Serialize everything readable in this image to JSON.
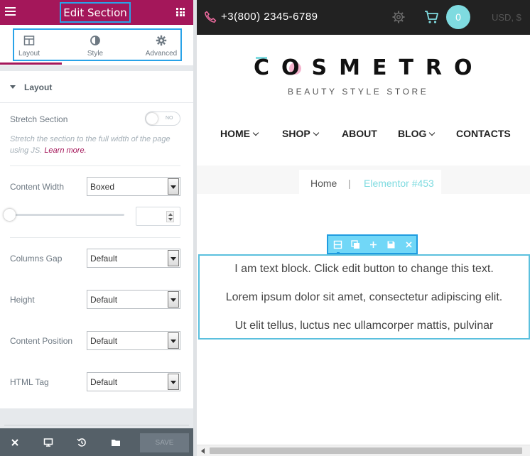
{
  "panel": {
    "title": "Edit Section",
    "tabs": [
      {
        "label": "Layout",
        "active": true
      },
      {
        "label": "Style",
        "active": false
      },
      {
        "label": "Advanced",
        "active": false
      }
    ],
    "accent_color": "#a4175a",
    "highlight_color": "#29a3e8"
  },
  "layout": {
    "section_title": "Layout",
    "stretch": {
      "label": "Stretch Section",
      "toggle_state": "NO",
      "hint": "Stretch the section to the full width of the page using JS.",
      "hint_link": "Learn more."
    },
    "content_width": {
      "label": "Content Width",
      "value": "Boxed"
    },
    "width_slider": {
      "value": "",
      "fill_fraction": 0
    },
    "columns_gap": {
      "label": "Columns Gap",
      "value": "Default"
    },
    "height": {
      "label": "Height",
      "value": "Default"
    },
    "content_position": {
      "label": "Content Position",
      "value": "Default"
    },
    "html_tag": {
      "label": "HTML Tag",
      "value": "Default"
    }
  },
  "footer": {
    "save_label": "SAVE",
    "icons": [
      "close-icon",
      "desktop-icon",
      "history-icon",
      "folder-icon"
    ]
  },
  "site": {
    "phone": "+3(800) 2345-6789",
    "cart_count": "0",
    "currency": "USD, $",
    "logo": "COSMETRO",
    "tagline": "BEAUTY STYLE STORE",
    "nav": [
      {
        "label": "HOME",
        "dropdown": true
      },
      {
        "label": "SHOP",
        "dropdown": true
      },
      {
        "label": "ABOUT",
        "dropdown": false
      },
      {
        "label": "BLOG",
        "dropdown": true
      },
      {
        "label": "CONTACTS",
        "dropdown": false
      }
    ],
    "breadcrumb": {
      "home": "Home",
      "separator": "|",
      "current": "Elementor #453"
    },
    "brand_color": "#7fdbe0",
    "text_block": {
      "lines": [
        "I am text block. Click edit button to change this text.",
        "Lorem ipsum dolor sit amet, consectetur adipiscing elit.",
        "Ut elit tellus, luctus nec ullamcorper mattis, pulvinar"
      ]
    }
  }
}
